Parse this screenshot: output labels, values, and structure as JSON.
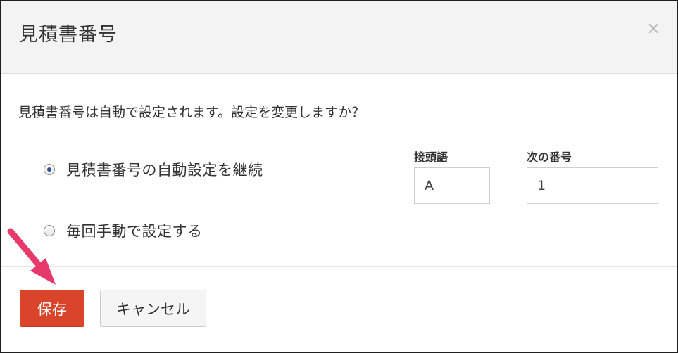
{
  "dialog": {
    "title": "見積書番号",
    "close_label": "×",
    "message": "見積書番号は自動で設定されます。設定を変更しますか？"
  },
  "options": [
    {
      "label": "見積書番号の自動設定を継続",
      "checked": true
    },
    {
      "label": "毎回手動で設定する",
      "checked": false
    }
  ],
  "fields": {
    "prefix": {
      "label": "接頭語",
      "value": "A"
    },
    "next_number": {
      "label": "次の番号",
      "value": "1"
    }
  },
  "footer": {
    "save_label": "保存",
    "cancel_label": "キャンセル"
  },
  "colors": {
    "save_button": "#d9442b",
    "annotation_arrow": "#e8396b"
  },
  "icons": {
    "close": "close-icon",
    "arrow": "pointer-arrow-icon"
  }
}
